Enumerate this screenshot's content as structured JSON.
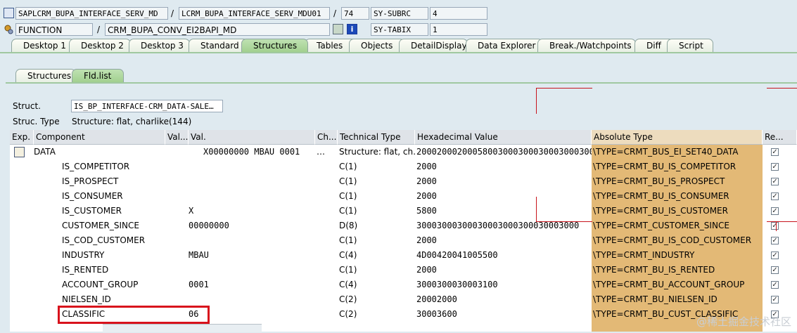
{
  "header": {
    "program": "SAPLCRM_BUPA_INTERFACE_SERV_MD",
    "include": "LCRM_BUPA_INTERFACE_SERV_MDU01",
    "line": "74",
    "sysvar1_name": "SY-SUBRC",
    "sysvar1_value": "4",
    "event_type": "FUNCTION",
    "event_name": "CRM_BUPA_CONV_EI2BAPI_MD",
    "sysvar2_name": "SY-TABIX",
    "sysvar2_value": "1"
  },
  "tabs": [
    "Desktop 1",
    "Desktop 2",
    "Desktop 3",
    "Standard",
    "Structures",
    "Tables",
    "Objects",
    "DetailDisplay",
    "Data Explorer",
    "Break./Watchpoints",
    "Diff",
    "Script"
  ],
  "active_tab": "Structures",
  "subtabs": [
    "Structures",
    "Fld.list"
  ],
  "active_subtab": "Fld.list",
  "struct_label": "Struct.",
  "struct_value": "IS_BP_INTERFACE-CRM_DATA-SALE…",
  "struc_type_label": "Struc. Type",
  "struc_type_value": "Structure: flat, charlike(144)",
  "grid": {
    "columns": [
      "Exp.",
      "Component",
      "Val...",
      "Val.",
      "Ch...",
      "Technical Type",
      "Hexadecimal Value",
      "Absolute Type",
      "Re..."
    ],
    "rows": [
      {
        "exp": "table-icon",
        "component": "DATA",
        "val_short": "",
        "val": "X00000000 MBAU 0001",
        "ch": "…",
        "tech": "Structure: flat, ch…",
        "hex": "200020002000580030003000300030003000…",
        "abs": "\\TYPE=CRMT_BUS_EI_SET40_DATA",
        "re": true
      },
      {
        "exp": "",
        "component": "IS_COMPETITOR",
        "val_short": "",
        "val": "",
        "ch": "",
        "tech": "C(1)",
        "hex": "2000",
        "abs": "\\TYPE=CRMT_BU_IS_COMPETITOR",
        "re": true
      },
      {
        "exp": "",
        "component": "IS_PROSPECT",
        "val_short": "",
        "val": "",
        "ch": "",
        "tech": "C(1)",
        "hex": "2000",
        "abs": "\\TYPE=CRMT_BU_IS_PROSPECT",
        "re": true
      },
      {
        "exp": "",
        "component": "IS_CONSUMER",
        "val_short": "",
        "val": "",
        "ch": "",
        "tech": "C(1)",
        "hex": "2000",
        "abs": "\\TYPE=CRMT_BU_IS_CONSUMER",
        "re": true
      },
      {
        "exp": "",
        "component": "IS_CUSTOMER",
        "val_short": "",
        "val": "X",
        "ch": "",
        "tech": "C(1)",
        "hex": "5800",
        "abs": "\\TYPE=CRMT_BU_IS_CUSTOMER",
        "re": true
      },
      {
        "exp": "",
        "component": "CUSTOMER_SINCE",
        "val_short": "",
        "val": "00000000",
        "ch": "",
        "tech": "D(8)",
        "hex": "30003000300030003000300030003000",
        "abs": "\\TYPE=CRMT_CUSTOMER_SINCE",
        "re": true
      },
      {
        "exp": "",
        "component": "IS_COD_CUSTOMER",
        "val_short": "",
        "val": "",
        "ch": "",
        "tech": "C(1)",
        "hex": "2000",
        "abs": "\\TYPE=CRMT_BU_IS_COD_CUSTOMER",
        "re": true
      },
      {
        "exp": "",
        "component": "INDUSTRY",
        "val_short": "",
        "val": "MBAU",
        "ch": "",
        "tech": "C(4)",
        "hex": "4D00420041005500",
        "abs": "\\TYPE=CRMT_INDUSTRY",
        "re": true
      },
      {
        "exp": "",
        "component": "IS_RENTED",
        "val_short": "",
        "val": "",
        "ch": "",
        "tech": "C(1)",
        "hex": "2000",
        "abs": "\\TYPE=CRMT_BU_IS_RENTED",
        "re": true
      },
      {
        "exp": "",
        "component": "ACCOUNT_GROUP",
        "val_short": "",
        "val": "0001",
        "ch": "",
        "tech": "C(4)",
        "hex": "3000300030003100",
        "abs": "\\TYPE=CRMT_BU_ACCOUNT_GROUP",
        "re": true
      },
      {
        "exp": "",
        "component": "NIELSEN_ID",
        "val_short": "",
        "val": "",
        "ch": "",
        "tech": "C(2)",
        "hex": "20002000",
        "abs": "\\TYPE=CRMT_BU_NIELSEN_ID",
        "re": true
      },
      {
        "exp": "",
        "component": "CLASSIFIC",
        "val_short": "",
        "val": "06",
        "ch": "",
        "tech": "C(2)",
        "hex": "30003600",
        "abs": "\\TYPE=CRMT_BU_CUST_CLASSIFIC",
        "re": true
      }
    ]
  },
  "watermark": "@稀土掘金技术社区",
  "colors": {
    "accent_tab": "#a2d08f",
    "abs_column": "#e3b976",
    "highlight": "#d8121c"
  }
}
